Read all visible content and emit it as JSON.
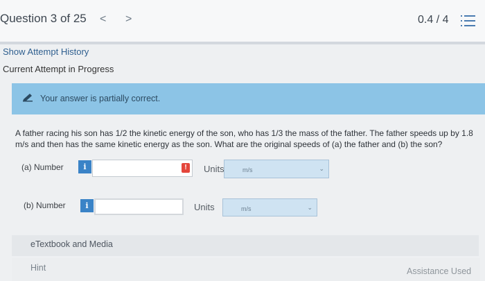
{
  "header": {
    "question_counter": "Question 3 of 25",
    "prev_icon": "chevron-left",
    "next_icon": "chevron-right",
    "score": "0.4 / 4",
    "menu_icon": "list-icon"
  },
  "attempt": {
    "show_history": "Show Attempt History",
    "current": "Current Attempt in Progress"
  },
  "feedback": {
    "icon": "pencil-icon",
    "text": "Your answer is partially correct."
  },
  "question": {
    "text": "A father racing his son has 1/2 the kinetic energy of the son, who has 1/3 the mass of the father. The father speeds up by 1.8 m/s and then has the same kinetic energy as the son. What are the original speeds of (a) the father and (b) the son?"
  },
  "parts": [
    {
      "label": "(a)  Number",
      "info": "i",
      "value": "",
      "alert": "!",
      "units_label": "Units",
      "units_value": "m/s"
    },
    {
      "label": "(b)  Number",
      "info": "i",
      "value": "",
      "units_label": "Units",
      "units_value": "m/s"
    }
  ],
  "footer": {
    "etextbook": "eTextbook and Media",
    "hint": "Hint",
    "assistance": "Assistance Used"
  },
  "colors": {
    "banner": "#8cc4e6",
    "info_button": "#3a83c7",
    "alert": "#e4463b",
    "select": "#cfe3f2"
  }
}
